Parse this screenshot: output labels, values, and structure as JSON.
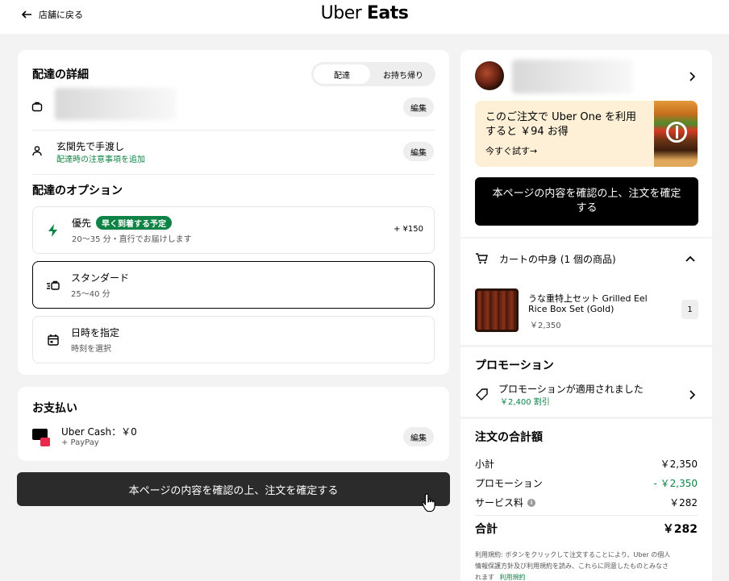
{
  "header": {
    "back_label": "店舗に戻る",
    "logo_part1": "Uber",
    "logo_part2": "Eats"
  },
  "delivery": {
    "title": "配達の詳細",
    "toggle": {
      "option1": "配達",
      "option2": "お持ち帰り"
    },
    "edit_label": "編集",
    "dropoff_title": "玄関先で手渡し",
    "dropoff_link": "配達時の注意事項を追加"
  },
  "options": {
    "title": "配達のオプション",
    "priority": {
      "label": "優先",
      "badge": "早く到着する予定",
      "sub": "20〜35 分・直行でお届けします",
      "price": "+ ¥150"
    },
    "standard": {
      "label": "スタンダード",
      "sub": "25〜40 分"
    },
    "schedule": {
      "label": "日時を指定",
      "sub": "時刻を選択"
    }
  },
  "payment": {
    "title": "お支払い",
    "method": "Uber Cash：￥0",
    "sub": "+ PayPay",
    "edit_label": "編集"
  },
  "confirm_button": "本ページの内容を確認の上、注文を確定する",
  "sidebar": {
    "promo_card": {
      "line1": "このご注文で Uber One を利用",
      "line2": "すると ￥94 お得",
      "cta": "今すぐ試す→"
    },
    "confirm_button_line1": "本ページの内容を確認の上、注文を確定",
    "confirm_button_line2": "する",
    "cart": {
      "title": "カートの中身 (1 個の商品)",
      "item_name_line1": "うな重特上セット Grilled Eel",
      "item_name_line2": "Rice Box Set (Gold)",
      "item_price": "￥2,350",
      "item_qty": "1"
    },
    "promotion": {
      "title": "プロモーション",
      "applied": "プロモーションが適用されました",
      "discount": "￥2,400 割引"
    },
    "total": {
      "title": "注文の合計額",
      "subtotal_label": "小計",
      "subtotal_value": "￥2,350",
      "promo_label": "プロモーション",
      "promo_value": "- ￥2,350",
      "fee_label": "サービス料",
      "fee_value": "￥282",
      "total_label": "合計",
      "total_value": "￥282",
      "terms_line1": "利用規約: ボタンをクリックして注文することにより、Uber の個人",
      "terms_line2": "情報保護方針及び利用規約を読み、これらに同意したものとみなさ",
      "terms_line3": "れます",
      "terms_link": "利用規約"
    }
  },
  "colors": {
    "accent_green": "#0e8345",
    "promo_bg": "#fdf0d7",
    "button_dark": "#2b2b2b"
  }
}
